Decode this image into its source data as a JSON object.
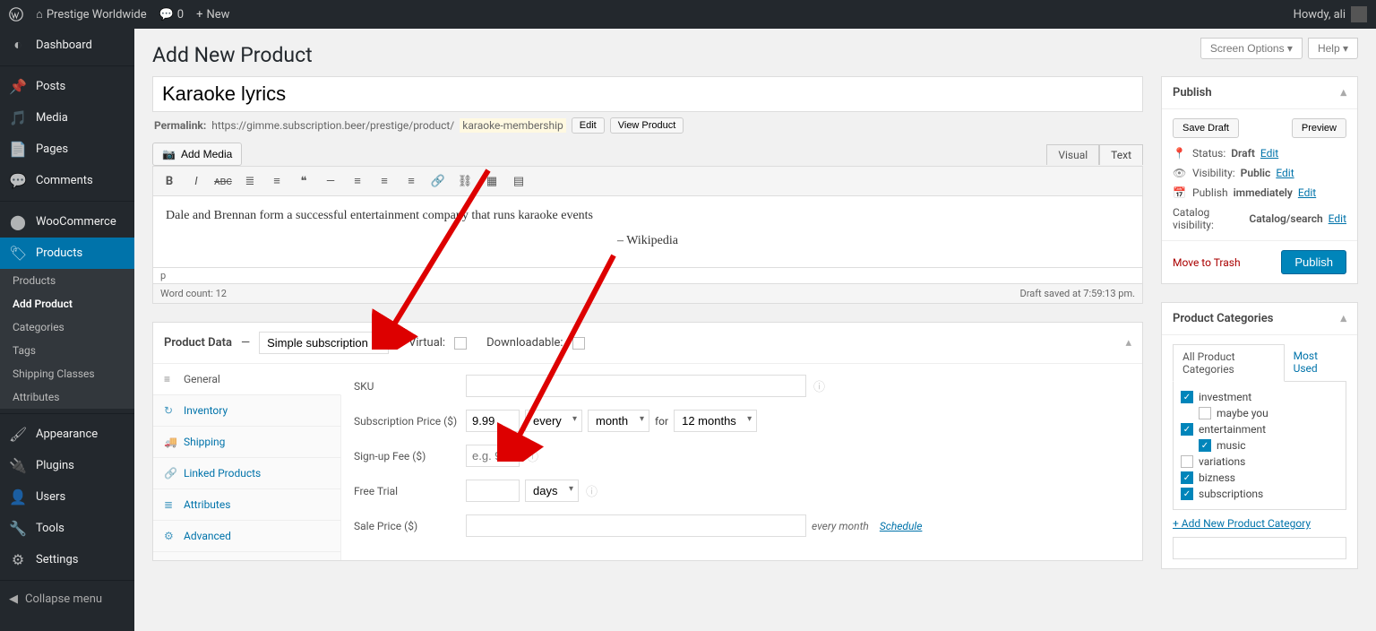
{
  "adminbar": {
    "site_name": "Prestige Worldwide",
    "comments": "0",
    "new": "New",
    "howdy": "Howdy, ali"
  },
  "sidebar": {
    "items": [
      {
        "icon": "dashboard",
        "label": "Dashboard"
      },
      {
        "icon": "posts",
        "label": "Posts"
      },
      {
        "icon": "media",
        "label": "Media"
      },
      {
        "icon": "pages",
        "label": "Pages"
      },
      {
        "icon": "comments",
        "label": "Comments"
      },
      {
        "icon": "woo",
        "label": "WooCommerce"
      },
      {
        "icon": "products",
        "label": "Products",
        "current": true
      },
      {
        "icon": "appearance",
        "label": "Appearance"
      },
      {
        "icon": "plugins",
        "label": "Plugins"
      },
      {
        "icon": "users",
        "label": "Users"
      },
      {
        "icon": "tools",
        "label": "Tools"
      },
      {
        "icon": "settings",
        "label": "Settings"
      }
    ],
    "submenu": [
      "Products",
      "Add Product",
      "Categories",
      "Tags",
      "Shipping Classes",
      "Attributes"
    ],
    "submenu_current": "Add Product",
    "collapse": "Collapse menu"
  },
  "screen_options": "Screen Options",
  "help": "Help",
  "page_title": "Add New Product",
  "product_title": "Karaoke lyrics",
  "permalink": {
    "label": "Permalink:",
    "base": "https://gimme.subscription.beer/prestige/product/",
    "slug": "karaoke-membership",
    "edit": "Edit",
    "view": "View Product"
  },
  "add_media": "Add Media",
  "editor_tabs": {
    "visual": "Visual",
    "text": "Text"
  },
  "editor_content": {
    "p1": "Dale and Brennan form a successful entertainment company that runs karaoke events",
    "p2": "– Wikipedia"
  },
  "editor_path": "p",
  "word_count_label": "Word count:",
  "word_count": "12",
  "draft_saved": "Draft saved at 7:59:13 pm.",
  "product_data": {
    "heading": "Product Data",
    "dash": "—",
    "type": "Simple subscription",
    "virtual": "Virtual:",
    "downloadable": "Downloadable:",
    "tabs": [
      "General",
      "Inventory",
      "Shipping",
      "Linked Products",
      "Attributes",
      "Advanced"
    ],
    "fields": {
      "sku": "SKU",
      "sub_price": "Subscription Price ($)",
      "sub_price_val": "9.99",
      "every": "every",
      "every_period": "month",
      "for": "for",
      "duration": "12 months",
      "signup": "Sign-up Fee ($)",
      "signup_ph": "e.g. 9.90",
      "trial": "Free Trial",
      "trial_unit": "days",
      "sale": "Sale Price ($)",
      "sale_meta": "every month",
      "schedule": "Schedule"
    }
  },
  "publish": {
    "heading": "Publish",
    "save_draft": "Save Draft",
    "preview": "Preview",
    "status_label": "Status:",
    "status_val": "Draft",
    "visibility_label": "Visibility:",
    "visibility_val": "Public",
    "publish_label": "Publish",
    "publish_val": "immediately",
    "catalog_label": "Catalog visibility:",
    "catalog_val": "Catalog/search",
    "edit": "Edit",
    "trash": "Move to Trash",
    "publish_btn": "Publish"
  },
  "categories": {
    "heading": "Product Categories",
    "all_tab": "All Product Categories",
    "most_used": "Most Used",
    "items": [
      {
        "label": "investment",
        "checked": true,
        "child": false
      },
      {
        "label": "maybe you",
        "checked": false,
        "child": true
      },
      {
        "label": "entertainment",
        "checked": true,
        "child": false
      },
      {
        "label": "music",
        "checked": true,
        "child": true
      },
      {
        "label": "variations",
        "checked": false,
        "child": false
      },
      {
        "label": "bizness",
        "checked": true,
        "child": false
      },
      {
        "label": "subscriptions",
        "checked": true,
        "child": false
      }
    ],
    "add_new": "+ Add New Product Category"
  }
}
